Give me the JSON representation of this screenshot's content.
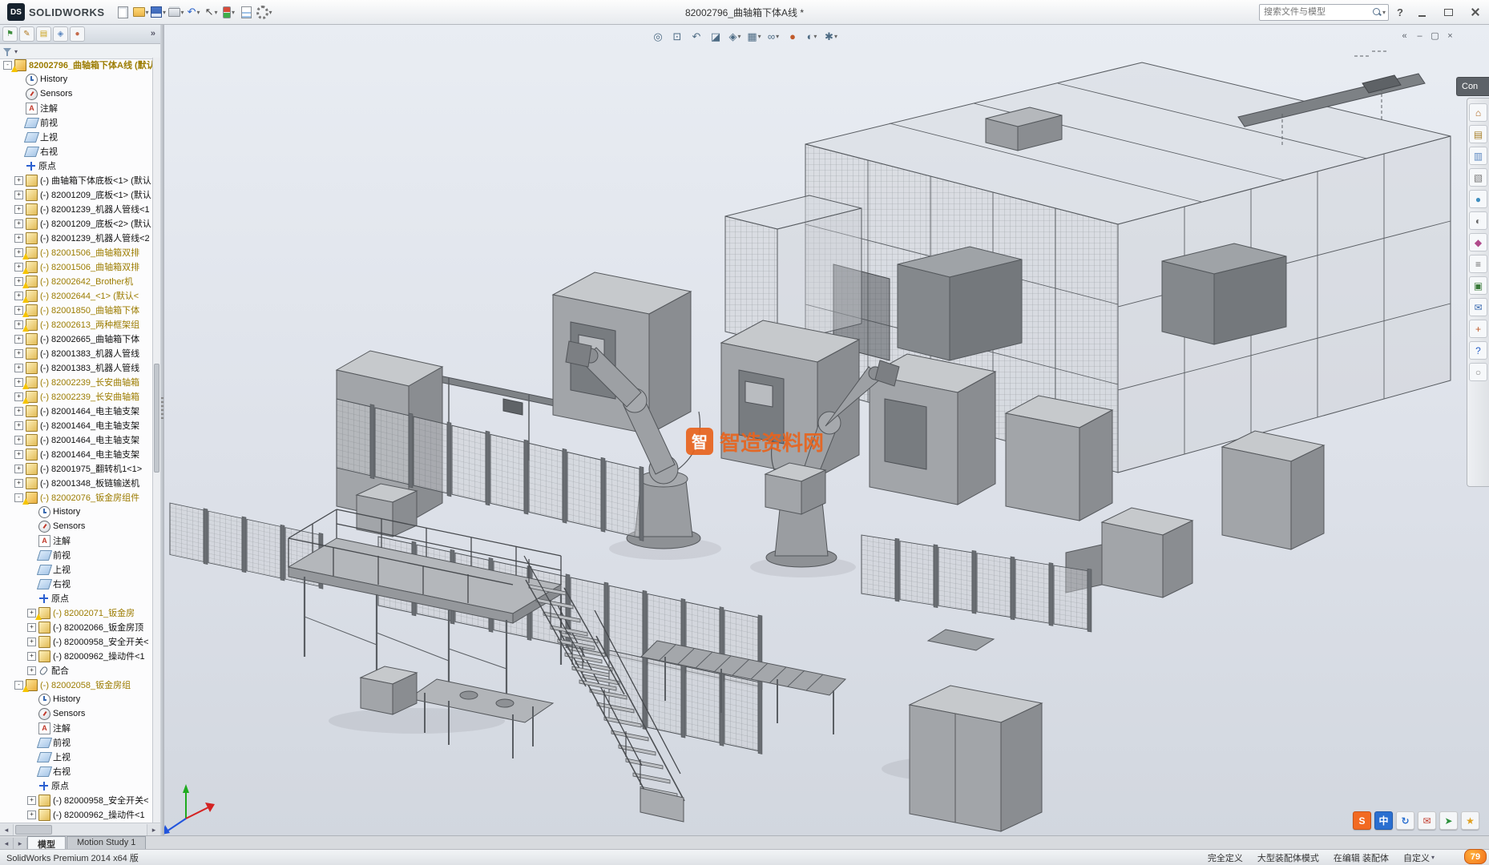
{
  "titlebar": {
    "logo_mark": "DS",
    "brand": "SOLIDWORKS",
    "title": "82002796_曲轴箱下体A线 *",
    "search_placeholder": "搜索文件与模型",
    "help_label": "?",
    "tools": [
      {
        "name": "new-file-button",
        "cls": "c-pg"
      },
      {
        "name": "open-file-button",
        "cls": "c-fold",
        "caret": true
      },
      {
        "name": "save-button",
        "cls": "c-disk",
        "caret": true
      },
      {
        "name": "print-button",
        "cls": "c-print",
        "caret": true
      },
      {
        "name": "undo-button",
        "glyph": "↶",
        "fg": "#2a62c9",
        "caret": true
      },
      {
        "name": "select-button",
        "glyph": "↖",
        "fg": "#444",
        "caret": true
      },
      {
        "name": "rebuild-button",
        "cls": "c-rebuild",
        "caret": true
      },
      {
        "name": "file-properties-button",
        "cls": "c-fileprop"
      },
      {
        "name": "options-button",
        "cls": "c-gear",
        "caret": true
      }
    ]
  },
  "panel": {
    "expand_chevron": "»",
    "filter_caret": "▾",
    "hscroll_left": "◂",
    "hscroll_right": "▸",
    "tabs": [
      {
        "name": "featuremanager-tab-icon",
        "glyph": "⚑",
        "fg": "#3f8f3f"
      },
      {
        "name": "propertymanager-tab-icon",
        "glyph": "✎",
        "fg": "#b07820"
      },
      {
        "name": "configurationmanager-tab-icon",
        "glyph": "▤",
        "fg": "#caa21a"
      },
      {
        "name": "dimxpert-tab-icon",
        "glyph": "◈",
        "fg": "#5b87c0"
      },
      {
        "name": "displaymanager-tab-icon",
        "glyph": "●",
        "fg": "#c56a4a"
      }
    ]
  },
  "tree": {
    "items": [
      {
        "label": "82002796_曲轴箱下体A线 (默认",
        "icon": "assembly",
        "level": 0,
        "expand": "open",
        "warn": true,
        "amber": true
      },
      {
        "label": "History",
        "icon": "history",
        "level": 1
      },
      {
        "label": "Sensors",
        "icon": "sensors",
        "level": 1
      },
      {
        "label": "注解",
        "icon": "ann",
        "level": 1
      },
      {
        "label": "前视",
        "icon": "plane",
        "level": 1
      },
      {
        "label": "上视",
        "icon": "plane",
        "level": 1
      },
      {
        "label": "右视",
        "icon": "plane",
        "level": 1
      },
      {
        "label": "原点",
        "icon": "origin",
        "level": 1
      },
      {
        "label": "(-) 曲轴箱下体底板<1> (默认",
        "icon": "part",
        "level": 1,
        "expand": "closed"
      },
      {
        "label": "(-) 82001209_底板<1> (默认",
        "icon": "part",
        "level": 1,
        "expand": "closed"
      },
      {
        "label": "(-) 82001239_机器人管线<1",
        "icon": "part",
        "level": 1,
        "expand": "closed"
      },
      {
        "label": "(-) 82001209_底板<2> (默认",
        "icon": "part",
        "level": 1,
        "expand": "closed"
      },
      {
        "label": "(-) 82001239_机器人管线<2",
        "icon": "part",
        "level": 1,
        "expand": "closed"
      },
      {
        "label": "(-) 82001506_曲轴箱双排",
        "icon": "part",
        "level": 1,
        "expand": "closed",
        "warn": true,
        "amber": true
      },
      {
        "label": "(-) 82001506_曲轴箱双排",
        "icon": "part",
        "level": 1,
        "expand": "closed",
        "warn": true,
        "amber": true
      },
      {
        "label": "(-) 82002642_Brother机",
        "icon": "part",
        "level": 1,
        "expand": "closed",
        "warn": true,
        "amber": true
      },
      {
        "label": "(-) 82002644_<1> (默认<",
        "icon": "part",
        "level": 1,
        "expand": "closed",
        "warn": true,
        "amber": true
      },
      {
        "label": "(-) 82001850_曲轴箱下体",
        "icon": "part",
        "level": 1,
        "expand": "closed",
        "warn": true,
        "amber": true
      },
      {
        "label": "(-) 82002613_两种框架组",
        "icon": "part",
        "level": 1,
        "expand": "closed",
        "warn": true,
        "amber": true
      },
      {
        "label": "(-) 82002665_曲轴箱下体",
        "icon": "part",
        "level": 1,
        "expand": "closed"
      },
      {
        "label": "(-) 82001383_机器人管线",
        "icon": "part",
        "level": 1,
        "expand": "closed"
      },
      {
        "label": "(-) 82001383_机器人管线",
        "icon": "part",
        "level": 1,
        "expand": "closed"
      },
      {
        "label": "(-) 82002239_长安曲轴箱",
        "icon": "part",
        "level": 1,
        "expand": "closed",
        "warn": true,
        "amber": true
      },
      {
        "label": "(-) 82002239_长安曲轴箱",
        "icon": "part",
        "level": 1,
        "expand": "closed",
        "warn": true,
        "amber": true
      },
      {
        "label": "(-) 82001464_电主轴支架",
        "icon": "part",
        "level": 1,
        "expand": "closed"
      },
      {
        "label": "(-) 82001464_电主轴支架",
        "icon": "part",
        "level": 1,
        "expand": "closed"
      },
      {
        "label": "(-) 82001464_电主轴支架",
        "icon": "part",
        "level": 1,
        "expand": "closed"
      },
      {
        "label": "(-) 82001464_电主轴支架",
        "icon": "part",
        "level": 1,
        "expand": "closed"
      },
      {
        "label": "(-) 82001975_翻转机1<1>",
        "icon": "part",
        "level": 1,
        "expand": "closed"
      },
      {
        "label": "(-) 82001348_板链输送机",
        "icon": "part",
        "level": 1,
        "expand": "closed"
      },
      {
        "label": "(-) 82002076_钣金房组件",
        "icon": "assembly",
        "level": 1,
        "expand": "open",
        "warn": true,
        "amber": true
      },
      {
        "label": "History",
        "icon": "history",
        "level": 2
      },
      {
        "label": "Sensors",
        "icon": "sensors",
        "level": 2
      },
      {
        "label": "注解",
        "icon": "ann",
        "level": 2
      },
      {
        "label": "前视",
        "icon": "plane",
        "level": 2
      },
      {
        "label": "上视",
        "icon": "plane",
        "level": 2
      },
      {
        "label": "右视",
        "icon": "plane",
        "level": 2
      },
      {
        "label": "原点",
        "icon": "origin",
        "level": 2
      },
      {
        "label": "(-) 82002071_钣金房",
        "icon": "part",
        "level": 2,
        "expand": "closed",
        "warn": true,
        "amber": true
      },
      {
        "label": "(-) 82002066_钣金房顶",
        "icon": "part",
        "level": 2,
        "expand": "closed"
      },
      {
        "label": "(-) 82000958_安全开关<",
        "icon": "part",
        "level": 2,
        "expand": "closed"
      },
      {
        "label": "(-) 82000962_操动件<1",
        "icon": "part",
        "level": 2,
        "expand": "closed"
      },
      {
        "label": "配合",
        "icon": "mates",
        "level": 2,
        "expand": "closed"
      },
      {
        "label": "(-) 82002058_钣金房组",
        "icon": "assembly",
        "level": 1,
        "expand": "open",
        "warn": true,
        "amber": true
      },
      {
        "label": "History",
        "icon": "history",
        "level": 2
      },
      {
        "label": "Sensors",
        "icon": "sensors",
        "level": 2
      },
      {
        "label": "注解",
        "icon": "ann",
        "level": 2
      },
      {
        "label": "前视",
        "icon": "plane",
        "level": 2
      },
      {
        "label": "上视",
        "icon": "plane",
        "level": 2
      },
      {
        "label": "右视",
        "icon": "plane",
        "level": 2
      },
      {
        "label": "原点",
        "icon": "origin",
        "level": 2
      },
      {
        "label": "(-) 82000958_安全开关<",
        "icon": "part",
        "level": 2,
        "expand": "closed"
      },
      {
        "label": "(-) 82000962_操动件<1",
        "icon": "part",
        "level": 2,
        "expand": "closed"
      }
    ]
  },
  "viewport": {
    "headsup_icons": [
      {
        "name": "zoom-fit-icon",
        "glyph": "◎"
      },
      {
        "name": "zoom-area-icon",
        "glyph": "⊡"
      },
      {
        "name": "previous-view-icon",
        "glyph": "↶"
      },
      {
        "name": "section-view-icon",
        "glyph": "◪"
      },
      {
        "name": "view-orientation-icon",
        "glyph": "◈",
        "caret": true
      },
      {
        "name": "display-style-icon",
        "glyph": "▦",
        "caret": true
      },
      {
        "name": "hide-show-icon",
        "glyph": "∞",
        "caret": true
      },
      {
        "name": "edit-appearance-icon",
        "glyph": "●",
        "fg": "#c05a2a"
      },
      {
        "name": "apply-scene-icon",
        "glyph": "◐",
        "caret": true
      },
      {
        "name": "view-settings-icon",
        "glyph": "✱",
        "caret": true
      }
    ],
    "doc_controls": [
      {
        "name": "collapse-arrows-icon",
        "glyph": "«"
      },
      {
        "name": "doc-minimize-button",
        "glyph": "–"
      },
      {
        "name": "doc-restore-button",
        "glyph": "▢"
      },
      {
        "name": "doc-close-button",
        "glyph": "×"
      }
    ],
    "corner_icons": [
      {
        "name": "solidworks-badge-icon",
        "glyph": "S",
        "bg": "#f26a22",
        "fg": "#fff"
      },
      {
        "name": "language-icon",
        "glyph": "中",
        "bg": "#2a6fd0",
        "fg": "#fff"
      },
      {
        "name": "refresh-icon",
        "glyph": "↻",
        "fg": "#2a6fd0"
      },
      {
        "name": "message-icon",
        "glyph": "✉",
        "fg": "#c0392b"
      },
      {
        "name": "share-icon",
        "glyph": "➤",
        "fg": "#2a8f3a"
      },
      {
        "name": "favorite-icon",
        "glyph": "★",
        "fg": "#e0a020"
      }
    ],
    "watermark_badge": "智",
    "watermark_text": "智造资料网"
  },
  "taskpane": {
    "header": "Con",
    "icons": [
      {
        "name": "resources-icon",
        "glyph": "⌂",
        "fg": "#b06820"
      },
      {
        "name": "design-library-icon",
        "glyph": "▤",
        "fg": "#a8812a"
      },
      {
        "name": "file-explorer-icon",
        "glyph": "▥",
        "fg": "#5b87c0"
      },
      {
        "name": "view-palette-icon",
        "glyph": "▧",
        "fg": "#777777"
      },
      {
        "name": "appearances-icon",
        "glyph": "●",
        "fg": "#3f8fc0"
      },
      {
        "name": "scene-icon",
        "glyph": "◐",
        "fg": "#666666"
      },
      {
        "name": "decals-icon",
        "glyph": "◆",
        "fg": "#b04a8a"
      },
      {
        "name": "properties-icon",
        "glyph": "≡",
        "fg": "#666666"
      },
      {
        "name": "pdm-icon",
        "glyph": "▣",
        "fg": "#3a7a3a"
      },
      {
        "name": "forum-icon",
        "glyph": "✉",
        "fg": "#3a6ab0"
      },
      {
        "name": "toolbox-icon",
        "glyph": "+",
        "fg": "#c05a2a"
      },
      {
        "name": "help-resources-icon",
        "glyph": "?",
        "fg": "#2a62c9"
      },
      {
        "name": "community-icon",
        "glyph": "○",
        "fg": "#888888"
      }
    ]
  },
  "tabsbar": {
    "nav_prev": "◂",
    "nav_next": "▸",
    "tabs": [
      {
        "label": "模型",
        "active": true
      },
      {
        "label": "Motion Study 1",
        "active": false
      }
    ]
  },
  "statusbar": {
    "product": "SolidWorks Premium 2014 x64 版",
    "defined": "完全定义",
    "mode": "大型装配体模式",
    "editing": "在编辑 装配体",
    "customize": "自定义",
    "customize_caret": "▾",
    "badge": "79"
  }
}
